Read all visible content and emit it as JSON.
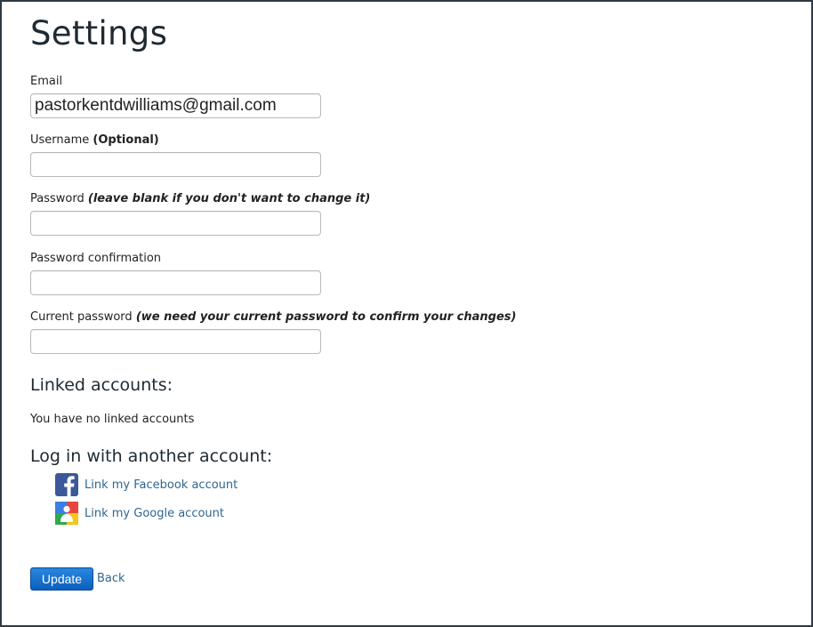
{
  "page": {
    "title": "Settings"
  },
  "form": {
    "email": {
      "label": "Email",
      "value": "pastorkentdwilliams@gmail.com"
    },
    "username": {
      "label": "Username",
      "note": "(Optional)",
      "value": ""
    },
    "password": {
      "label": "Password",
      "note": "(leave blank if you don't want to change it)",
      "value": ""
    },
    "password_confirmation": {
      "label": "Password confirmation",
      "value": ""
    },
    "current_password": {
      "label": "Current password",
      "note": "(we need your current password to confirm your changes)",
      "value": ""
    }
  },
  "linked": {
    "heading": "Linked accounts:",
    "empty_text": "You have no linked accounts"
  },
  "login_other": {
    "heading": "Log in with another account:",
    "providers": [
      {
        "label": "Link my Facebook account",
        "icon": "facebook-icon",
        "color": "#3b5998"
      },
      {
        "label": "Link my Google account",
        "icon": "google-icon"
      }
    ]
  },
  "actions": {
    "update_label": "Update",
    "back_label": "Back"
  },
  "colors": {
    "link": "#2f6690",
    "primary_button": "#0b5fbf",
    "title": "#1f2a33"
  }
}
